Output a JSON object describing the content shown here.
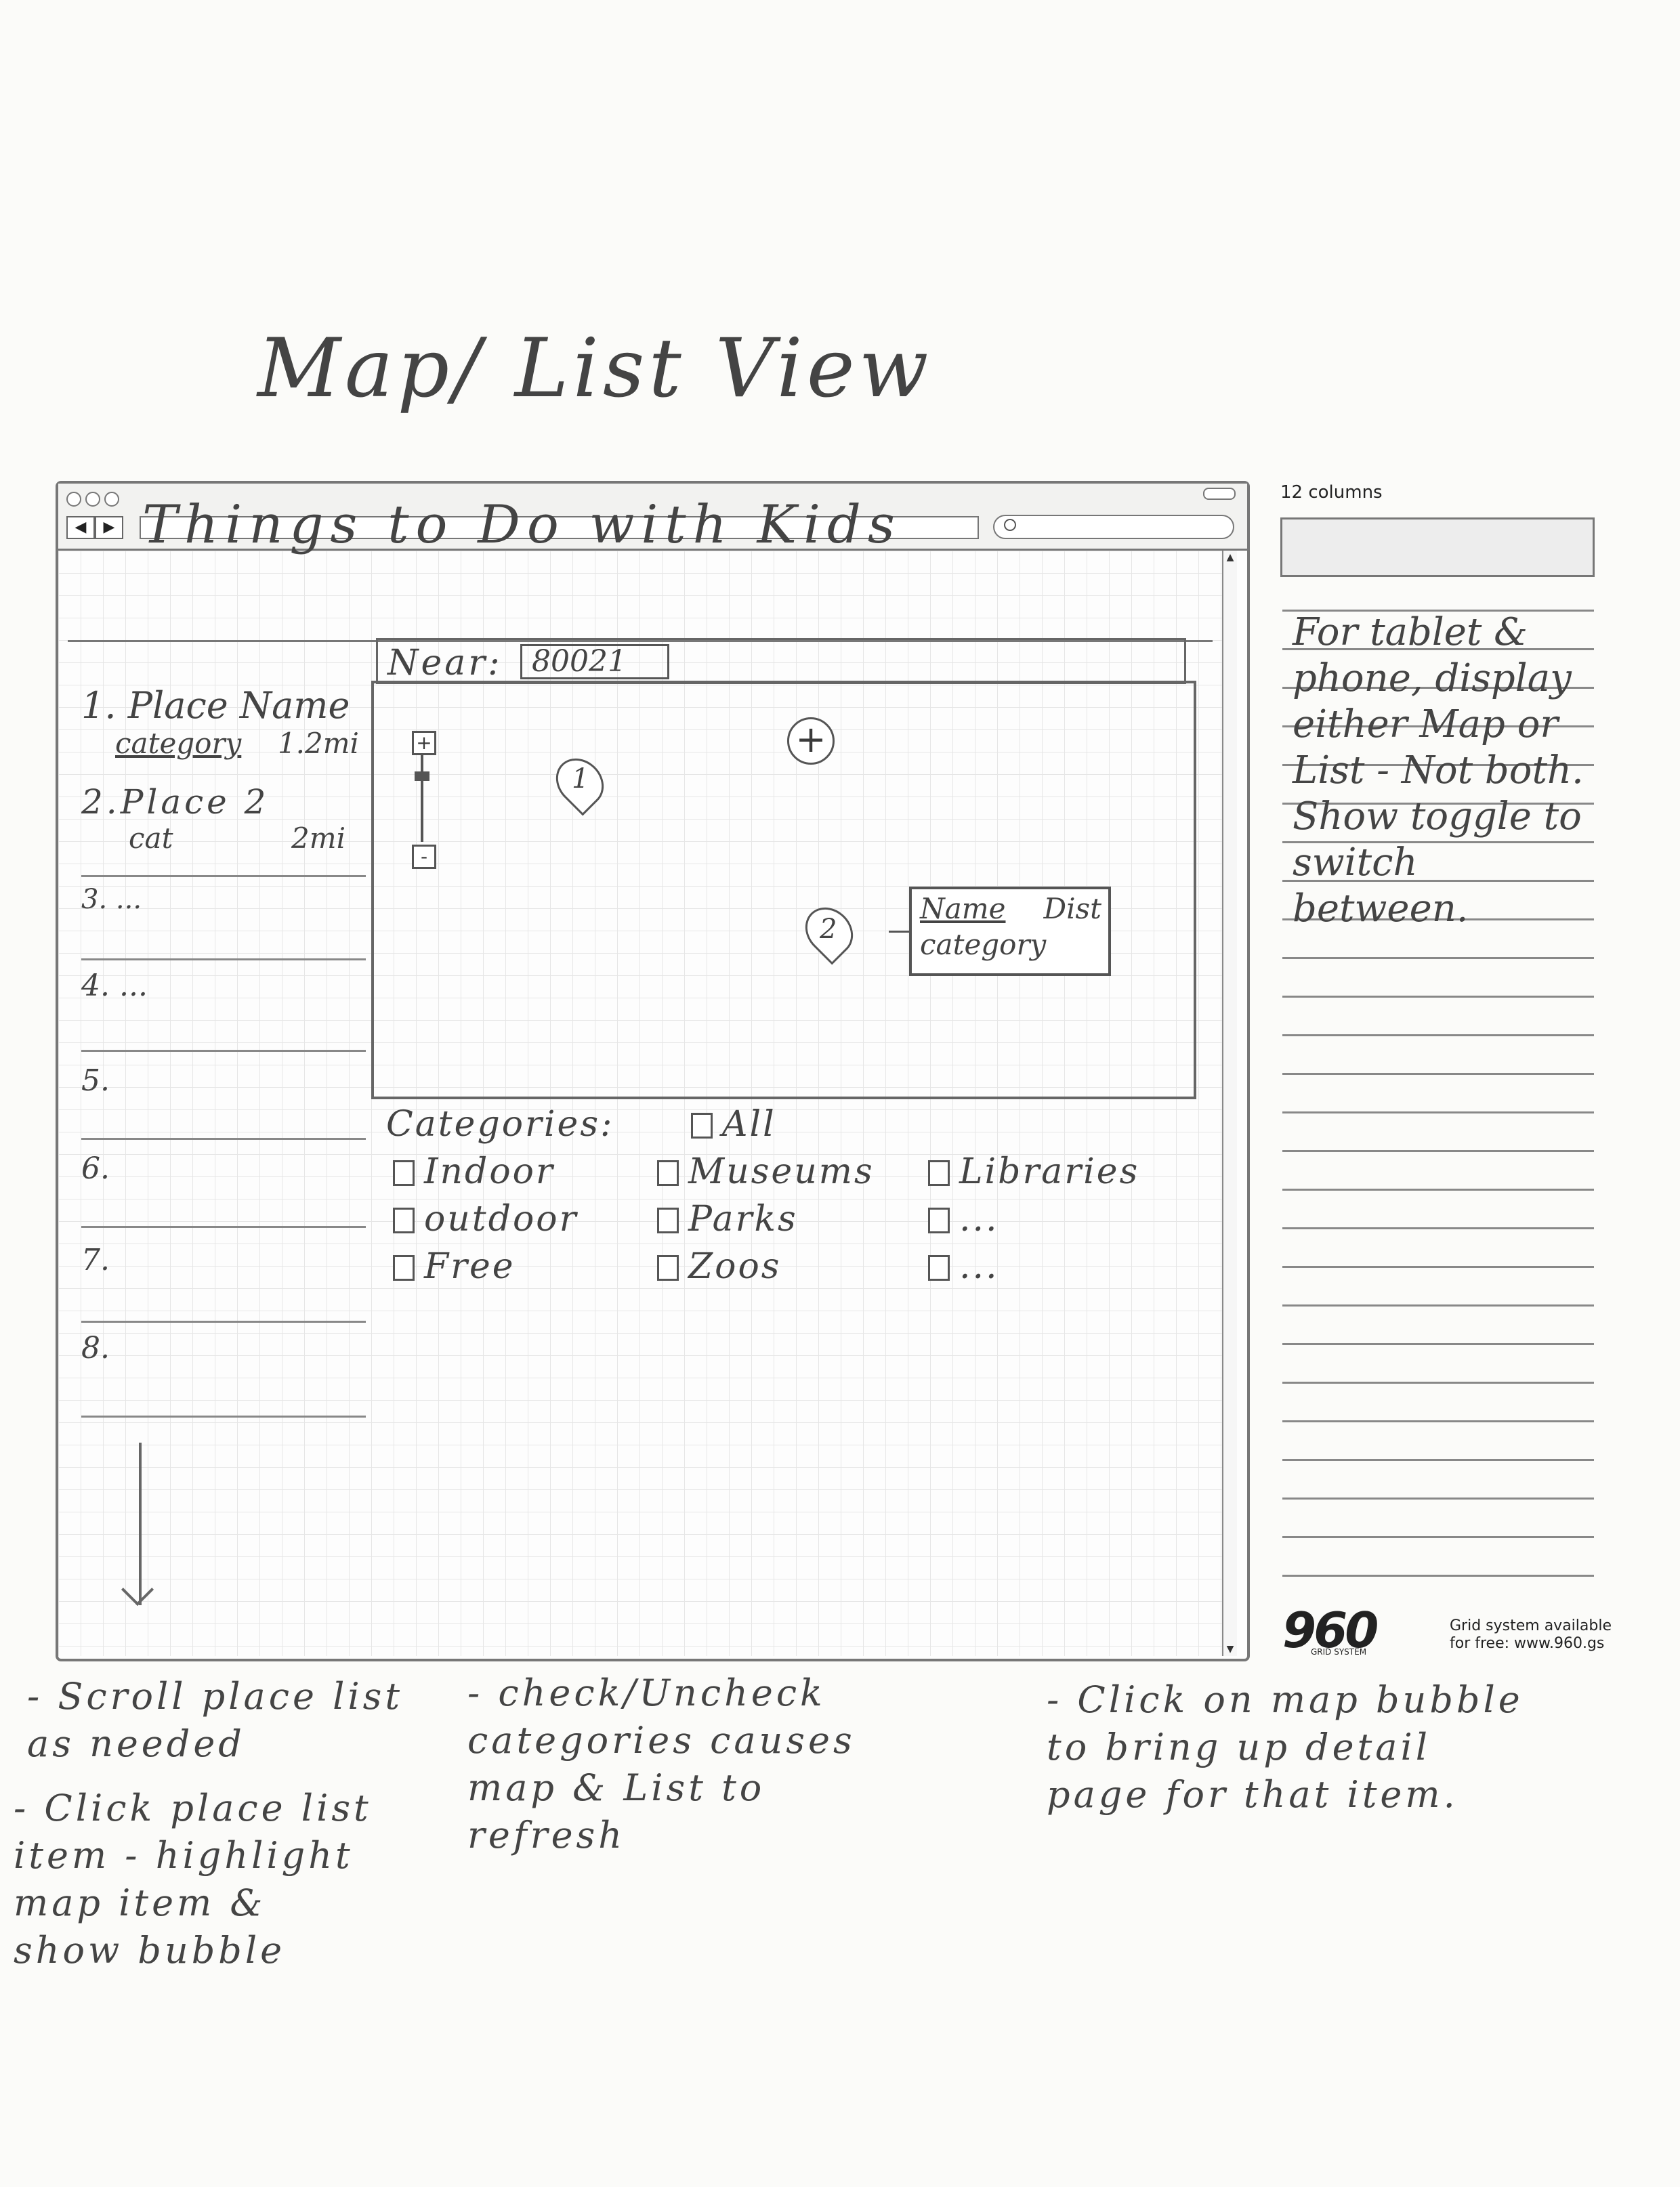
{
  "sketch": {
    "title": "Map/ List View"
  },
  "page": {
    "heading": "Things to Do with Kids",
    "near_label": "Near:",
    "near_value": "80021"
  },
  "place_list": [
    {
      "number": "1.",
      "name": "Place Name",
      "category": "category",
      "distance": "1.2mi"
    },
    {
      "number": "2.",
      "name": "Place 2",
      "category": "cat",
      "distance": "2mi"
    },
    {
      "number": "3.",
      "name": "...",
      "category": "",
      "distance": ""
    },
    {
      "number": "4.",
      "name": "...",
      "category": "",
      "distance": ""
    },
    {
      "number": "5.",
      "name": "",
      "category": "",
      "distance": ""
    },
    {
      "number": "6.",
      "name": "",
      "category": "",
      "distance": ""
    },
    {
      "number": "7.",
      "name": "",
      "category": "",
      "distance": ""
    },
    {
      "number": "8.",
      "name": "",
      "category": "",
      "distance": ""
    }
  ],
  "map": {
    "zoom_in": "+",
    "zoom_out": "-",
    "plus": "+",
    "pin1": "1",
    "pin2": "2",
    "bubble_name": "Name",
    "bubble_dist": "Dist",
    "bubble_category": "category"
  },
  "categories": {
    "label": "Categories:",
    "all": "All",
    "items": [
      "Indoor",
      "Museums",
      "Libraries",
      "outdoor",
      "Parks",
      "...",
      "Free",
      "Zoos",
      "..."
    ]
  },
  "grid": {
    "columns_label": "12 columns",
    "logo": "960",
    "logo_sub": "GRID SYSTEM",
    "note_line1": "Grid system available",
    "note_line2": "for free: www.960.gs"
  },
  "side_note": "For tablet & phone, display either Map or List - Not both. Show toggle to switch between.",
  "annotations": {
    "scroll": "- Scroll place list\n  as needed",
    "click_item": "- Click place list\n  item - highlight\n  map item &\n  show bubble",
    "categories": "- check/Uncheck\n  categories causes\n  map & List to\n  refresh",
    "bubble": "- Click on map bubble\n  to bring up detail\n  page for that item."
  }
}
